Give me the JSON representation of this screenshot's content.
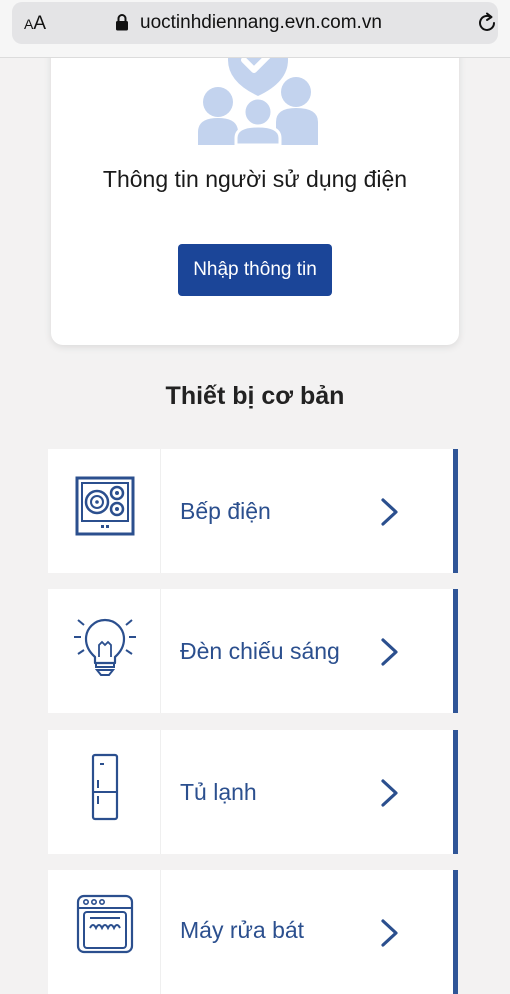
{
  "browser": {
    "text_size_label_small": "A",
    "text_size_label_large": "A",
    "url": "uoctinhdiennang.evn.com.vn"
  },
  "user_card": {
    "title": "Thông tin người sử dụng điện",
    "button_label": "Nhập thông tin"
  },
  "section": {
    "title": "Thiết bị cơ bản"
  },
  "devices": [
    {
      "label": "Bếp điện",
      "icon": "stove-icon"
    },
    {
      "label": "Đèn chiếu sáng",
      "icon": "light-bulb-icon"
    },
    {
      "label": "Tủ lạnh",
      "icon": "fridge-icon"
    },
    {
      "label": "Máy rửa bát",
      "icon": "dishwasher-icon"
    }
  ],
  "colors": {
    "primary_button": "#1b4598",
    "label_text": "#2b4f8e",
    "accent_bar": "#2f5597",
    "icon_light": "#c3d3ee",
    "background": "#f3f2f2"
  }
}
